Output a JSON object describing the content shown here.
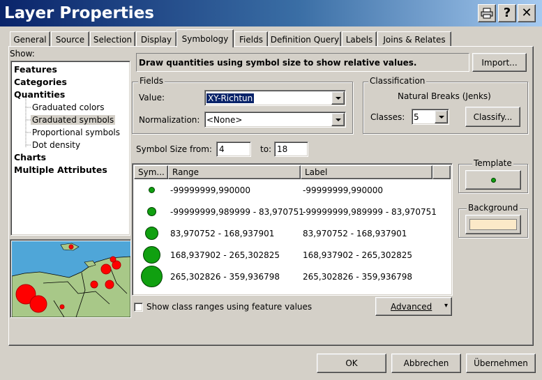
{
  "window": {
    "title": "Layer Properties",
    "buttons": {
      "print": "🖶",
      "help": "?",
      "close": "✕"
    }
  },
  "tabs": [
    {
      "label": "General"
    },
    {
      "label": "Source"
    },
    {
      "label": "Selection"
    },
    {
      "label": "Display"
    },
    {
      "label": "Symbology",
      "active": true
    },
    {
      "label": "Fields"
    },
    {
      "label": "Definition Query"
    },
    {
      "label": "Labels"
    },
    {
      "label": "Joins & Relates"
    }
  ],
  "show": {
    "label": "Show:",
    "tree": [
      {
        "label": "Features",
        "bold": true
      },
      {
        "label": "Categories",
        "bold": true
      },
      {
        "label": "Quantities",
        "bold": true
      },
      {
        "label": "Graduated colors",
        "indent": true
      },
      {
        "label": "Graduated symbols",
        "indent": true,
        "selected": true
      },
      {
        "label": "Proportional symbols",
        "indent": true
      },
      {
        "label": "Dot density",
        "indent": true
      },
      {
        "label": "Charts",
        "bold": true
      },
      {
        "label": "Multiple Attributes",
        "bold": true
      }
    ]
  },
  "description": "Draw quantities using symbol size to show relative values.",
  "import_button": "Import...",
  "fields": {
    "group_label": "Fields",
    "value_label": "Value:",
    "value": "XY-Richtun",
    "normalization_label": "Normalization:",
    "normalization": "<None>"
  },
  "classification": {
    "group_label": "Classification",
    "method": "Natural Breaks (Jenks)",
    "classes_label": "Classes:",
    "classes": "5",
    "classify_button": "Classify..."
  },
  "symbol_size": {
    "from_label": "Symbol Size from:",
    "from": "4",
    "to_label": "to:",
    "to": "18"
  },
  "table": {
    "headers": {
      "symbol": "Sym...",
      "range": "Range",
      "label": "Label"
    },
    "rows": [
      {
        "range": "-99999999,990000",
        "label": "-99999999,990000"
      },
      {
        "range": "-99999999,989999 - 83,970751",
        "label": "-99999999,989999 - 83,970751"
      },
      {
        "range": "83,970752 - 168,937901",
        "label": "83,970752 - 168,937901"
      },
      {
        "range": "168,937902 - 265,302825",
        "label": "168,937902 - 265,302825"
      },
      {
        "range": "265,302826 - 359,936798",
        "label": "265,302826 - 359,936798"
      }
    ]
  },
  "show_class_ranges": {
    "label": "Show class ranges using feature values",
    "checked": false
  },
  "advanced_button": "Advanced",
  "template_label": "Template",
  "background_label": "Background",
  "colors": {
    "symbol_fill": "#10a010",
    "background_swatch": "#fbe9c8",
    "map_water": "#4fa6d8",
    "map_land": "#a8c888",
    "map_points": "#ff0000"
  },
  "footer": {
    "ok": "OK",
    "cancel": "Abbrechen",
    "apply": "Übernehmen"
  }
}
